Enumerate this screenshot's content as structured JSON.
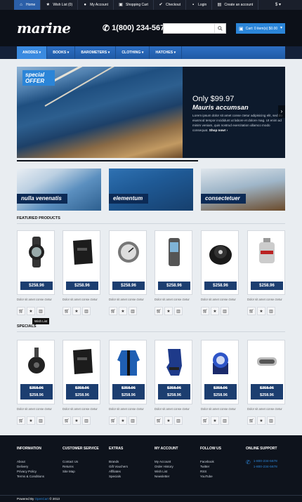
{
  "topbar": {
    "items": [
      {
        "label": "Home",
        "icon": "home-icon"
      },
      {
        "label": "Wish List (0)",
        "icon": "star-icon"
      },
      {
        "label": "My Account",
        "icon": "user-icon"
      },
      {
        "label": "Shopping Cart",
        "icon": "cart-icon"
      },
      {
        "label": "Checkout",
        "icon": "check-icon"
      },
      {
        "label": "Login",
        "icon": "lock-icon"
      },
      {
        "label": "Create an account",
        "icon": "doc-icon"
      }
    ],
    "currency": "$"
  },
  "header": {
    "logo": "marine",
    "phone": "1(800) 234-5678",
    "search_placeholder": "",
    "cart": "Cart: 0 item(s) $0.00"
  },
  "nav": {
    "items": [
      {
        "label": "Anodes"
      },
      {
        "label": "Books"
      },
      {
        "label": "Barometers"
      },
      {
        "label": "Clothing"
      },
      {
        "label": "Hatches"
      }
    ]
  },
  "banner": {
    "badge_line1": "special",
    "badge_line2": "OFFER",
    "price": "Only $99.97",
    "title": "Mauris accumsan",
    "desc": "Lorem ipsum dolor sit amet conse ctetur adipisicing elit, sed do eiusmod tempor incididunt ut labore et dolore mag. Ut enim ad minim veniam, quis nostrud exercitation ullamco modo consequat.",
    "shop": "Shop now!"
  },
  "promos": [
    {
      "label": "nulla venenatis",
      "color": "#5b8fbf"
    },
    {
      "label": "elementum",
      "color": "#1f5a96"
    },
    {
      "label": "consectetuer",
      "color": "#9fb6c9"
    }
  ],
  "featured": {
    "title": "Featured Products",
    "products": [
      {
        "price": "$258.96",
        "desc": "Dolor sit amet conse ctetur"
      },
      {
        "price": "$258.96",
        "desc": "Dolor sit amet conse ctetur"
      },
      {
        "price": "$258.96",
        "desc": "Dolor sit amet conse ctetur"
      },
      {
        "price": "$258.96",
        "desc": "Dolor sit amet conse ctetur"
      },
      {
        "price": "$258.96",
        "desc": "Dolor sit amet conse ctetur"
      },
      {
        "price": "$258.96",
        "desc": "Dolor sit amet conse ctetur"
      }
    ]
  },
  "tooltip": "Wish List",
  "specials": {
    "title": "Specials",
    "products": [
      {
        "old": "$358.96",
        "price": "$258.96",
        "desc": "Dolor sit amet conse ctetur"
      },
      {
        "old": "$358.96",
        "price": "$258.96",
        "desc": "Dolor sit amet conse ctetur"
      },
      {
        "old": "$358.96",
        "price": "$258.96",
        "desc": "Dolor sit amet conse ctetur"
      },
      {
        "old": "$358.96",
        "price": "$258.96",
        "desc": "Dolor sit amet conse ctetur"
      },
      {
        "old": "$358.96",
        "price": "$258.96",
        "desc": "Dolor sit amet conse ctetur"
      },
      {
        "old": "$358.96",
        "price": "$258.96",
        "desc": "Dolor sit amet conse ctetur"
      }
    ]
  },
  "footer": {
    "information": {
      "title": "Information",
      "links": [
        "About",
        "Delivery",
        "Privacy Policy",
        "Terms & Conditions"
      ]
    },
    "customer_service": {
      "title": "Customer Service",
      "links": [
        "Contact Us",
        "Returns",
        "Site Map"
      ]
    },
    "extras": {
      "title": "Extras",
      "links": [
        "Brands",
        "Gift Vouchers",
        "Affiliates",
        "Specials"
      ]
    },
    "my_account": {
      "title": "My Account",
      "links": [
        "My Account",
        "Order History",
        "Wish List",
        "Newsletter"
      ]
    },
    "follow_us": {
      "title": "Follow Us",
      "links": [
        "Facebook",
        "Twitter",
        "RSS",
        "YouTube"
      ]
    },
    "online_support": {
      "title": "Online Support",
      "phones": [
        "1-800-234-5678",
        "1-800-234-5678"
      ]
    },
    "powered_by": "Powered By",
    "powered_brand": "OpenCart",
    "copyright": "© 2013"
  }
}
